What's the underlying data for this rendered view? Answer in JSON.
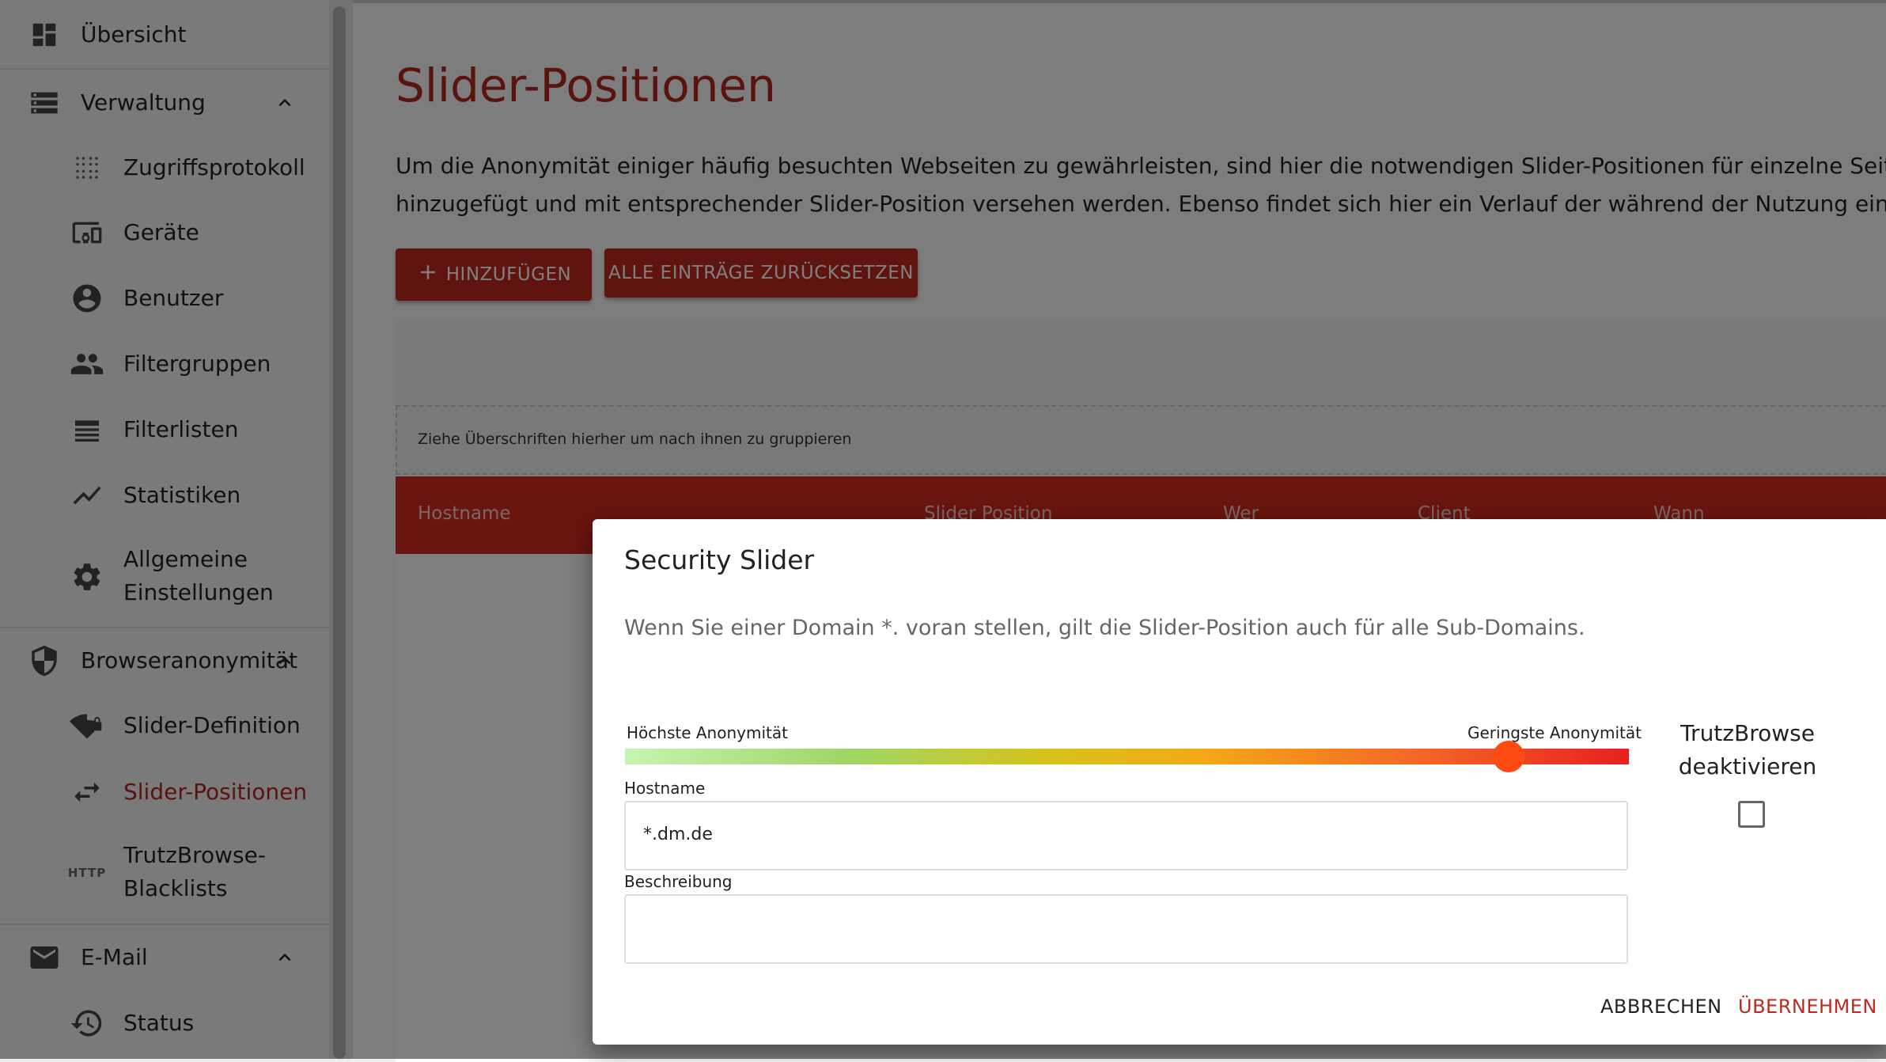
{
  "sidebar": {
    "items": [
      {
        "label": "Übersicht",
        "icon": "dashboard-icon"
      },
      {
        "label": "Verwaltung",
        "icon": "list-icon"
      },
      {
        "label": "Zugriffsprotokoll",
        "icon": "dots-grid-icon"
      },
      {
        "label": "Geräte",
        "icon": "devices-icon"
      },
      {
        "label": "Benutzer",
        "icon": "account-circle-icon"
      },
      {
        "label": "Filtergruppen",
        "icon": "group-icon"
      },
      {
        "label": "Filterlisten",
        "icon": "lines-icon"
      },
      {
        "label": "Statistiken",
        "icon": "trending-icon"
      },
      {
        "label": "Allgemeine",
        "label2": "Einstellungen",
        "icon": "gear-icon"
      },
      {
        "label": "Browseranonymität",
        "icon": "shield-icon"
      },
      {
        "label": "Slider-Definition",
        "icon": "wifi-slash-icon"
      },
      {
        "label": "Slider-Positionen",
        "icon": "swap-arrows-icon",
        "active": true
      },
      {
        "label": "TrutzBrowse-",
        "label2": "Blacklists",
        "icon_text": "HTTP",
        "icon": "http-icon"
      },
      {
        "label": "E-Mail",
        "icon": "mail-icon"
      },
      {
        "label": "Status",
        "icon": "history-icon"
      }
    ]
  },
  "main": {
    "title": "Slider-Positionen",
    "intro_line1": "Um die Anonymität einiger häufig besuchten Webseiten zu gewährleisten, sind hier die notwendigen Slider-Positionen für einzelne Seiten bereits fe",
    "intro_line2": "hinzugefügt und mit entsprechender Slider-Position versehen werden. Ebenso findet sich hier ein Verlauf der während der Nutzung eines Browsers",
    "add_button": "HINZUFÜGEN",
    "reset_button": "ALLE EINTRÄGE ZURÜCKSETZEN",
    "group_hint": "Ziehe Überschriften hierher um nach ihnen zu gruppieren",
    "columns": [
      "Hostname",
      "Slider Position",
      "Wer",
      "Client",
      "Wann"
    ]
  },
  "dialog": {
    "title": "Security Slider",
    "text": "Wenn Sie einer Domain *. voran stellen, gilt die Slider-Position auch für alle Sub-Domains.",
    "slider_min_label": "Höchste Anonymität",
    "slider_max_label": "Geringste Anonymität",
    "slider_value": 0.88,
    "hostname_label": "Hostname",
    "hostname_value": "*.dm.de",
    "description_label": "Beschreibung",
    "description_value": "",
    "trutz_label1": "TrutzBrowse",
    "trutz_label2": "deaktivieren",
    "trutz_checked": false,
    "cancel": "ABBRECHEN",
    "apply": "ÜBERNEHMEN"
  },
  "colors": {
    "accent": "#b4281e",
    "header_red": "#d42a1e",
    "button_red": "#c0281f",
    "slider_thumb": "#ff4a12"
  }
}
